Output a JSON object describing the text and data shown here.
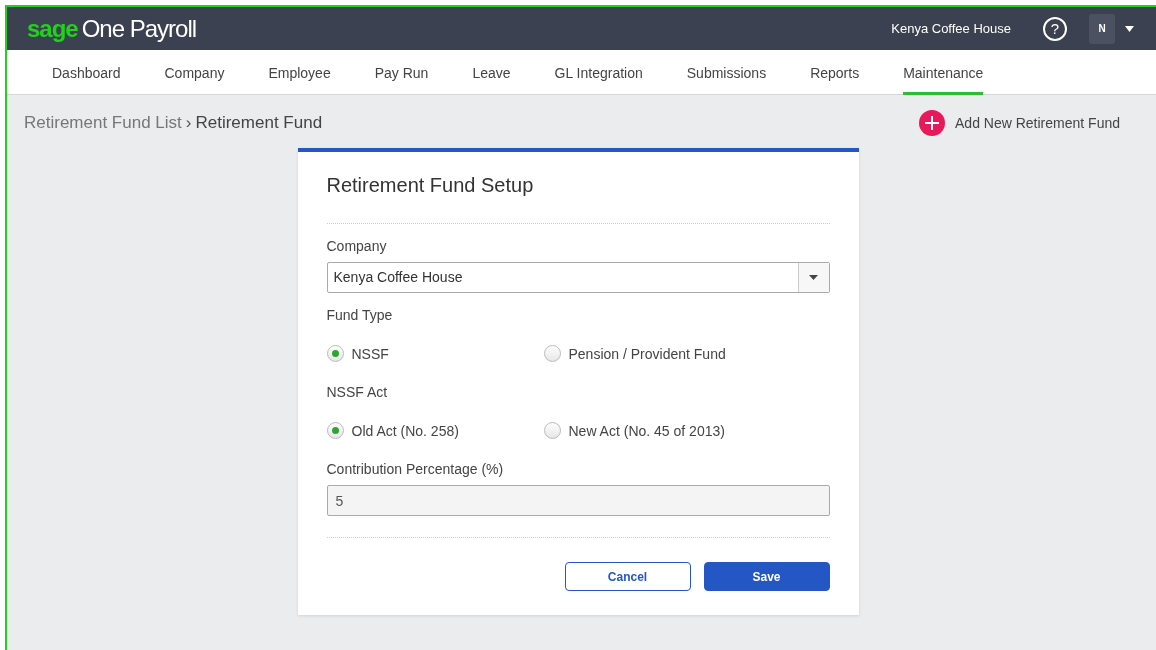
{
  "header": {
    "logo_brand": "sage",
    "logo_product": "One Payroll",
    "company": "Kenya Coffee House",
    "help": "?",
    "avatar": "N"
  },
  "nav": [
    {
      "label": "Dashboard",
      "selected": false
    },
    {
      "label": "Company",
      "selected": false
    },
    {
      "label": "Employee",
      "selected": false
    },
    {
      "label": "Pay Run",
      "selected": false
    },
    {
      "label": "Leave",
      "selected": false
    },
    {
      "label": "GL Integration",
      "selected": false
    },
    {
      "label": "Submissions",
      "selected": false
    },
    {
      "label": "Reports",
      "selected": false
    },
    {
      "label": "Maintenance",
      "selected": true
    }
  ],
  "breadcrumb": {
    "parent": "Retirement Fund List",
    "separator": "›",
    "current": "Retirement Fund"
  },
  "add_button": "Add New Retirement Fund",
  "form": {
    "title": "Retirement Fund Setup",
    "company": {
      "label": "Company",
      "value": "Kenya Coffee House"
    },
    "fund_type": {
      "label": "Fund Type",
      "options": [
        {
          "label": "NSSF",
          "selected": true
        },
        {
          "label": "Pension / Provident Fund",
          "selected": false
        }
      ]
    },
    "nssf_act": {
      "label": "NSSF Act",
      "options": [
        {
          "label": "Old Act (No. 258)",
          "selected": true
        },
        {
          "label": "New Act (No. 45 of 2013)",
          "selected": false
        }
      ]
    },
    "contribution": {
      "label": "Contribution Percentage (%)",
      "value": "5",
      "disabled": true
    },
    "buttons": {
      "cancel": "Cancel",
      "save": "Save"
    }
  }
}
